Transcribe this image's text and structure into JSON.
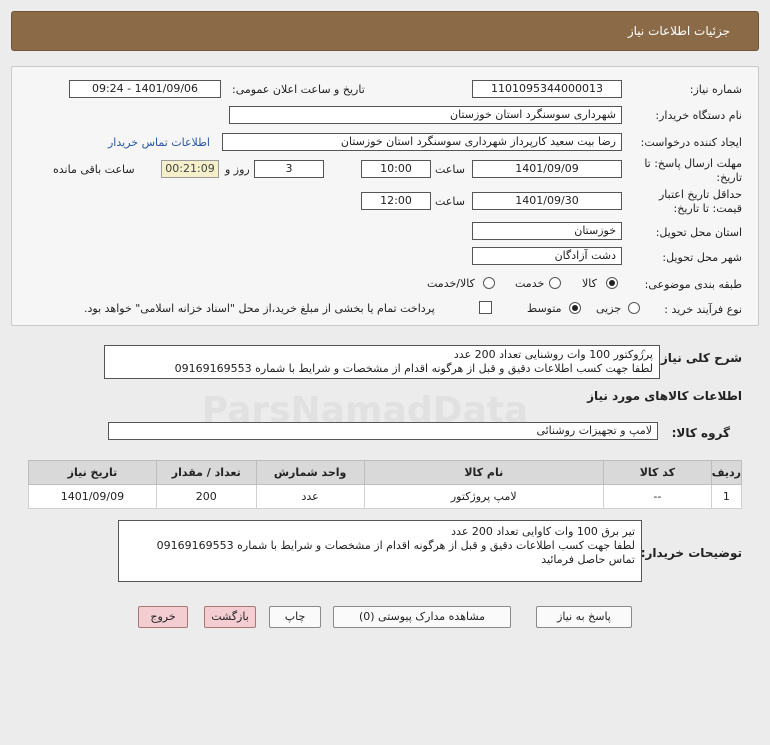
{
  "header": {
    "title": "جزئیات اطلاعات نیاز"
  },
  "form": {
    "need_number_label": "شماره نیاز:",
    "need_number": "1101095344000013",
    "announce_label": "تاریخ و ساعت اعلان عمومی:",
    "announce_value": "1401/09/06 - 09:24",
    "buyer_org_label": "نام دستگاه خریدار:",
    "buyer_org": "شهرداری سوسنگرد استان خوزستان",
    "requester_label": "ایجاد کننده درخواست:",
    "requester": "رضا بیت سعید کارپرداز شهرداری سوسنگرد استان خوزستان",
    "contact_link": "اطلاعات تماس خریدار",
    "deadline_label": "مهلت ارسال پاسخ: تا",
    "deadline_label2": "تاریخ:",
    "deadline_date": "1401/09/09",
    "time_label": "ساعت",
    "deadline_time": "10:00",
    "days": "3",
    "days_label": "روز و",
    "remaining_time": "00:21:09",
    "remaining_label": "ساعت باقی مانده",
    "validity_label": "حداقل تاریخ اعتبار",
    "validity_label2": "قیمت: تا تاریخ:",
    "validity_date": "1401/09/30",
    "validity_time_label": "ساعت",
    "validity_time": "12:00",
    "delivery_province_label": "استان محل تحویل:",
    "delivery_province": "خوزستان",
    "delivery_city_label": "شهر محل تحویل:",
    "delivery_city": "دشت آزادگان",
    "category_label": "طبقه بندی موضوعی:",
    "category_options": [
      "کالا",
      "خدمت",
      "کالا/خدمت"
    ],
    "process_label": "نوع فرآیند خرید :",
    "process_options": [
      "جزیی",
      "متوسط"
    ],
    "payment_note": "پرداخت تمام یا بخشی از مبلغ خرید،از محل \"اسناد خزانه اسلامی\" خواهد بود."
  },
  "summary": {
    "label": "شرح کلی نیاز:",
    "line1": "پرژوکتور  100 وات روشنایی تعداد 200 عدد",
    "line2": "لطفا جهت کسب اطلاعات دقیق و قبل از هرگونه اقدام از مشخصات و شرایط با شماره 09169169553"
  },
  "goods_section": {
    "title": "اطلاعات کالاهای مورد نیاز",
    "group_label": "گروه کالا:",
    "group_value": "لامپ و تجهیزات روشنائی"
  },
  "table": {
    "headers": [
      "ردیف",
      "کد کالا",
      "نام کالا",
      "واحد شمارش",
      "تعداد / مقدار",
      "تاریخ نیاز"
    ],
    "rows": [
      [
        "1",
        "--",
        "لامپ پروژکتور",
        "عدد",
        "200",
        "1401/09/09"
      ]
    ]
  },
  "buyer_notes": {
    "label": "توضیحات خریدار:",
    "line1": "تیر برق 100 وات کاوایی تعداد 200 عدد",
    "line2": "لطفا جهت کسب اطلاعات دقیق و قبل از هرگونه اقدام از مشخصات و شرایط با شماره 09169169553",
    "line3": "تماس حاصل فرمائید"
  },
  "buttons": {
    "reply": "پاسخ به نیاز",
    "attachments": "مشاهده مدارک پیوستی (0)",
    "print": "چاپ",
    "back": "بازگشت",
    "exit": "خروج"
  },
  "watermark": "ParsNamadData"
}
